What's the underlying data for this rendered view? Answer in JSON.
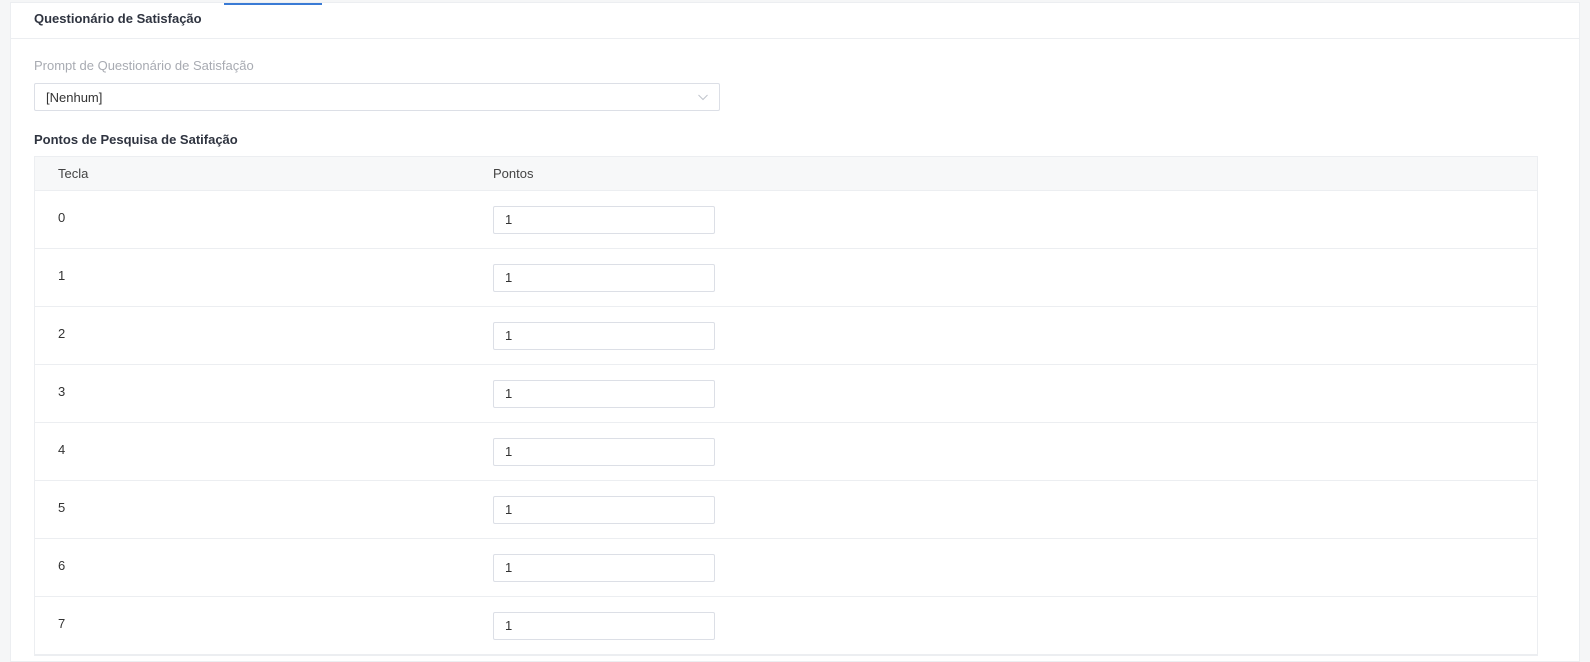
{
  "section": {
    "title": "Questionário de Satisfação"
  },
  "prompt": {
    "label": "Prompt de Questionário de Satisfação",
    "selected": "[Nenhum]",
    "chevron_icon": "chevron-down-icon"
  },
  "points": {
    "title": "Pontos de Pesquisa de Satifação",
    "columns": {
      "key": "Tecla",
      "points": "Pontos"
    },
    "rows": [
      {
        "key": "0",
        "points": "1"
      },
      {
        "key": "1",
        "points": "1"
      },
      {
        "key": "2",
        "points": "1"
      },
      {
        "key": "3",
        "points": "1"
      },
      {
        "key": "4",
        "points": "1"
      },
      {
        "key": "5",
        "points": "1"
      },
      {
        "key": "6",
        "points": "1"
      },
      {
        "key": "7",
        "points": "1"
      }
    ]
  },
  "colors": {
    "accent": "#3a7bd5",
    "border": "#dcdfe6",
    "header_bg": "#f7f8f9"
  }
}
